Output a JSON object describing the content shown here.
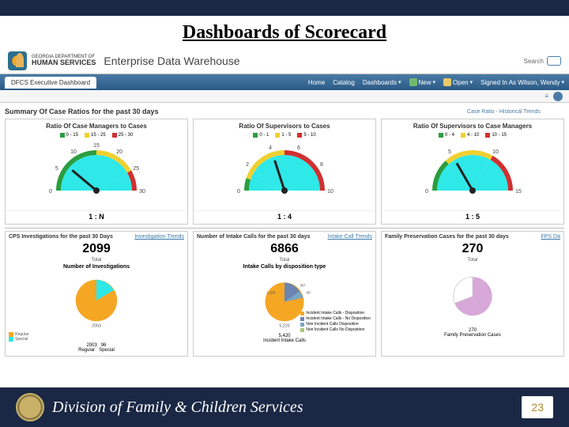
{
  "slide": {
    "title": "Dashboards of Scorecard",
    "page_number": "23"
  },
  "header": {
    "dept_line1": "GEORGIA DEPARTMENT OF",
    "dept_line2": "HUMAN SERVICES",
    "app_title": "Enterprise Data Warehouse",
    "search_label": "Search"
  },
  "nav": {
    "active_tab": "DFCS Executive Dashboard",
    "items": {
      "home": "Home",
      "catalog": "Catalog",
      "dashboards": "Dashboards",
      "new": "New",
      "open": "Open",
      "signed_in": "Signed In As Wilson, Wendy"
    }
  },
  "summary": {
    "title": "Summary Of Case Ratios for the past 30 days",
    "link": "Case Ratio - Historical Trends"
  },
  "gauges": [
    {
      "title": "Ratio Of Case Managers to Cases",
      "legend": [
        "0 - 15",
        "15 - 25",
        "25 - 30"
      ],
      "ticks": [
        "0",
        "5",
        "10",
        "15",
        "20",
        "25",
        "30"
      ],
      "value": "1 : N",
      "arc": [
        [
          "#2a9d3f",
          0,
          90
        ],
        [
          "#f0d030",
          90,
          150
        ],
        [
          "#d03030",
          150,
          180
        ]
      ],
      "needle_deg": 40
    },
    {
      "title": "Ratio Of Supervisors to Cases",
      "legend": [
        "0 - 1",
        "1 - 5",
        "5 - 10"
      ],
      "ticks": [
        "0",
        "2",
        "4",
        "6",
        "8",
        "10"
      ],
      "value": "1 : 4",
      "arc": [
        [
          "#2a9d3f",
          0,
          18
        ],
        [
          "#f0d030",
          18,
          90
        ],
        [
          "#d03030",
          90,
          180
        ]
      ],
      "needle_deg": 72
    },
    {
      "title": "Ratio Of Supervisors to Case Managers",
      "legend": [
        "0 - 4",
        "4 - 10",
        "10 - 15"
      ],
      "ticks": [
        "0",
        "5",
        "10",
        "15"
      ],
      "value": "1 : 5",
      "arc": [
        [
          "#2a9d3f",
          0,
          48
        ],
        [
          "#f0d030",
          48,
          120
        ],
        [
          "#d03030",
          120,
          180
        ]
      ],
      "needle_deg": 60
    }
  ],
  "metrics": [
    {
      "header": "CPS Investigations for the past 30 Days",
      "link": "Investigation Trends",
      "big": "2099",
      "big_label": "Total",
      "chart_title": "Number of Investigations",
      "footer_a": "2003",
      "footer_a_lbl": "Regular",
      "footer_b": "96",
      "footer_b_lbl": "Special"
    },
    {
      "header": "Number of Intake Calls for the past 30 days",
      "link": "Intake Call Trends",
      "big": "6866",
      "big_label": "Total",
      "chart_title": "Intake Calls by disposition type",
      "footer": "5,420",
      "footer_lbl": "Incident Intake Calls"
    },
    {
      "header": "Family Preservation Cases for the past 30 days",
      "link": "FPS Da",
      "big": "270",
      "big_label": "Total",
      "chart_title": "",
      "footer": "270",
      "footer_lbl": "Family Preservation Cases"
    }
  ],
  "pie2_legend": [
    {
      "color": "#f5a623",
      "label": "Incident Intake Calls - Disposition"
    },
    {
      "color": "#6a85b0",
      "label": "Incident Intake Calls - No Disposition"
    },
    {
      "color": "#7aa6c9",
      "label": "Non Incident Calls Disposition"
    },
    {
      "color": "#a8c97a",
      "label": "Non Incident Calls No Disposition"
    }
  ],
  "footer": {
    "org": "Division of Family & Children Services"
  },
  "chart_data": {
    "gauges": [
      {
        "type": "gauge",
        "title": "Ratio Of Case Managers to Cases",
        "ranges": [
          {
            "color": "green",
            "min": 0,
            "max": 15
          },
          {
            "color": "yellow",
            "min": 15,
            "max": 25
          },
          {
            "color": "red",
            "min": 25,
            "max": 30
          }
        ],
        "value": 7,
        "max": 30
      },
      {
        "type": "gauge",
        "title": "Ratio Of Supervisors to Cases",
        "ranges": [
          {
            "color": "green",
            "min": 0,
            "max": 1
          },
          {
            "color": "yellow",
            "min": 1,
            "max": 5
          },
          {
            "color": "red",
            "min": 5,
            "max": 10
          }
        ],
        "value": 4,
        "max": 10
      },
      {
        "type": "gauge",
        "title": "Ratio Of Supervisors to Case Managers",
        "ranges": [
          {
            "color": "green",
            "min": 0,
            "max": 4
          },
          {
            "color": "yellow",
            "min": 4,
            "max": 10
          },
          {
            "color": "red",
            "min": 10,
            "max": 15
          }
        ],
        "value": 5,
        "max": 15
      }
    ],
    "pies": [
      {
        "type": "pie",
        "title": "Number of Investigations",
        "series": [
          {
            "name": "Regular",
            "value": 2003
          },
          {
            "name": "Special",
            "value": 96
          }
        ],
        "total": 2099
      },
      {
        "type": "pie",
        "title": "Intake Calls by disposition type",
        "series": [
          {
            "name": "Incident - Disposition",
            "value": 5220
          },
          {
            "name": "Incident - No Disposition",
            "value": 1199
          },
          {
            "name": "Non Incident Disposition",
            "value": 387
          },
          {
            "name": "Non Incident No Disposition",
            "value": 60
          }
        ],
        "total": 6866
      },
      {
        "type": "pie",
        "title": "Family Preservation Cases",
        "series": [
          {
            "name": "Family Preservation",
            "value": 270
          }
        ],
        "total": 270
      }
    ]
  }
}
